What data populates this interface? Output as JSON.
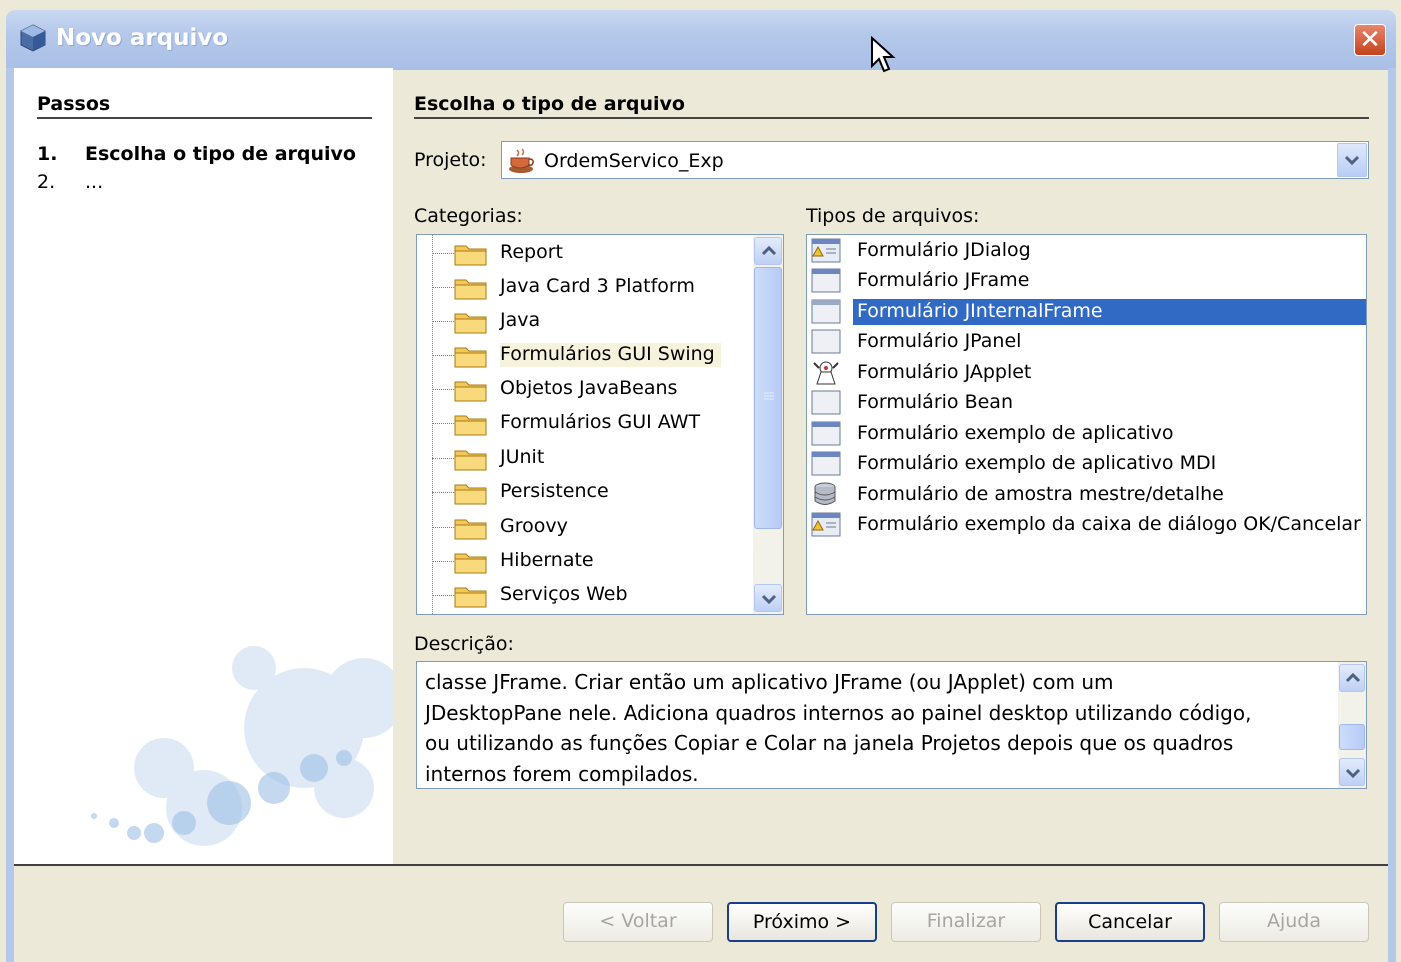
{
  "window": {
    "title": "Novo arquivo",
    "close_glyph": "✕"
  },
  "steps": {
    "title": "Passos",
    "items": [
      {
        "num": "1.",
        "label": "Escolha o tipo de arquivo"
      },
      {
        "num": "2.",
        "label": "..."
      }
    ]
  },
  "main": {
    "title": "Escolha o tipo de arquivo",
    "project_label": "Projeto:",
    "project_value": "OrdemServico_Exp",
    "categories_label": "Categorias:",
    "file_types_label": "Tipos de arquivos:",
    "categories": [
      "Report",
      "Java Card 3 Platform",
      "Java",
      "Formulários GUI Swing",
      "Objetos JavaBeans",
      "Formulários GUI AWT",
      "JUnit",
      "Persistence",
      "Groovy",
      "Hibernate",
      "Serviços Web"
    ],
    "selected_category": "Formulários GUI Swing",
    "file_types": [
      {
        "label": "Formulário JDialog",
        "icon": "dialog-form-icon"
      },
      {
        "label": "Formulário JFrame",
        "icon": "frame-form-icon"
      },
      {
        "label": "Formulário JInternalFrame",
        "icon": "internal-frame-form-icon"
      },
      {
        "label": "Formulário JPanel",
        "icon": "panel-form-icon"
      },
      {
        "label": "Formulário JApplet",
        "icon": "applet-form-icon"
      },
      {
        "label": "Formulário Bean",
        "icon": "bean-form-icon"
      },
      {
        "label": "Formulário exemplo de aplicativo",
        "icon": "frame-form-icon"
      },
      {
        "label": "Formulário exemplo de aplicativo MDI",
        "icon": "frame-form-icon"
      },
      {
        "label": "Formulário de amostra mestre/detalhe",
        "icon": "database-icon"
      },
      {
        "label": "Formulário exemplo da caixa de diálogo OK/Cancelar",
        "icon": "dialog-form-icon"
      }
    ],
    "selected_file_type": "Formulário JInternalFrame",
    "description_label": "Descrição:",
    "description_lines": [
      "classe JFrame. Criar então um aplicativo JFrame (ou JApplet) com um",
      "JDesktopPane nele. Adiciona quadros internos ao painel desktop utilizando código,",
      "ou utilizando as funções Copiar e Colar na janela Projetos depois que os quadros",
      "internos forem compilados."
    ]
  },
  "buttons": {
    "back": "< Voltar",
    "next": "Próximo >",
    "finish": "Finalizar",
    "cancel": "Cancelar",
    "help": "Ajuda"
  },
  "colors": {
    "selection": "#316ac5",
    "title_bar": "#b4c8ea",
    "dialog_bg": "#ece9d8"
  }
}
